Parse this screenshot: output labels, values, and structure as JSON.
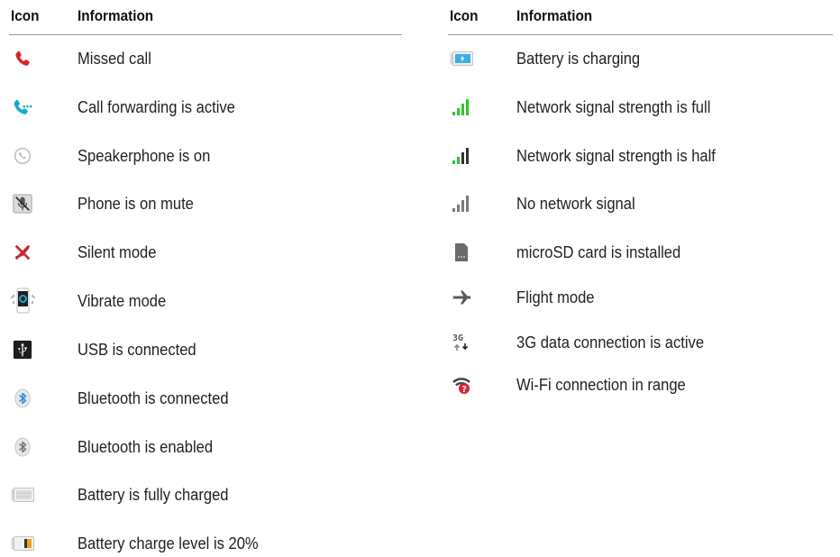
{
  "headers": {
    "icon": "Icon",
    "information": "Information"
  },
  "left_rows": [
    {
      "icon": "missed-call-icon",
      "text": "Missed call"
    },
    {
      "icon": "call-forwarding-icon",
      "text": "Call forwarding is active"
    },
    {
      "icon": "speakerphone-icon",
      "text": "Speakerphone is on"
    },
    {
      "icon": "mute-icon",
      "text": "Phone is on mute"
    },
    {
      "icon": "silent-mode-icon",
      "text": "Silent mode"
    },
    {
      "icon": "vibrate-mode-icon",
      "text": "Vibrate mode"
    },
    {
      "icon": "usb-icon",
      "text": "USB is connected"
    },
    {
      "icon": "bluetooth-connected-icon",
      "text": "Bluetooth is  connected"
    },
    {
      "icon": "bluetooth-enabled-icon",
      "text": "Bluetooth is enabled"
    },
    {
      "icon": "battery-full-icon",
      "text": "Battery is fully charged"
    },
    {
      "icon": "battery-low-icon",
      "text": "Battery charge level is 20%"
    }
  ],
  "right_rows": [
    {
      "icon": "battery-charging-icon",
      "text": "Battery is charging"
    },
    {
      "icon": "signal-full-icon",
      "text": "Network signal strength is full"
    },
    {
      "icon": "signal-half-icon",
      "text": "Network signal strength is half"
    },
    {
      "icon": "no-signal-icon",
      "text": "No network signal"
    },
    {
      "icon": "microsd-icon",
      "text": "microSD card is installed"
    },
    {
      "icon": "flight-mode-icon",
      "text": "Flight mode"
    },
    {
      "icon": "3g-data-icon",
      "text": "3G data connection is active"
    },
    {
      "icon": "wifi-in-range-icon",
      "text": "Wi-Fi connection in range"
    }
  ],
  "colors": {
    "missed_call": "#d0262b",
    "call_forwarding": "#1aa9c9",
    "signal_green": "#2fc52f",
    "signal_gray": "#7a7a7a",
    "bluetooth_blue": "#3f8fd8",
    "battery_low": "#f2a11b",
    "wifi_alert": "#d8232a"
  },
  "icon_glyphs": {
    "3g": "3G"
  }
}
